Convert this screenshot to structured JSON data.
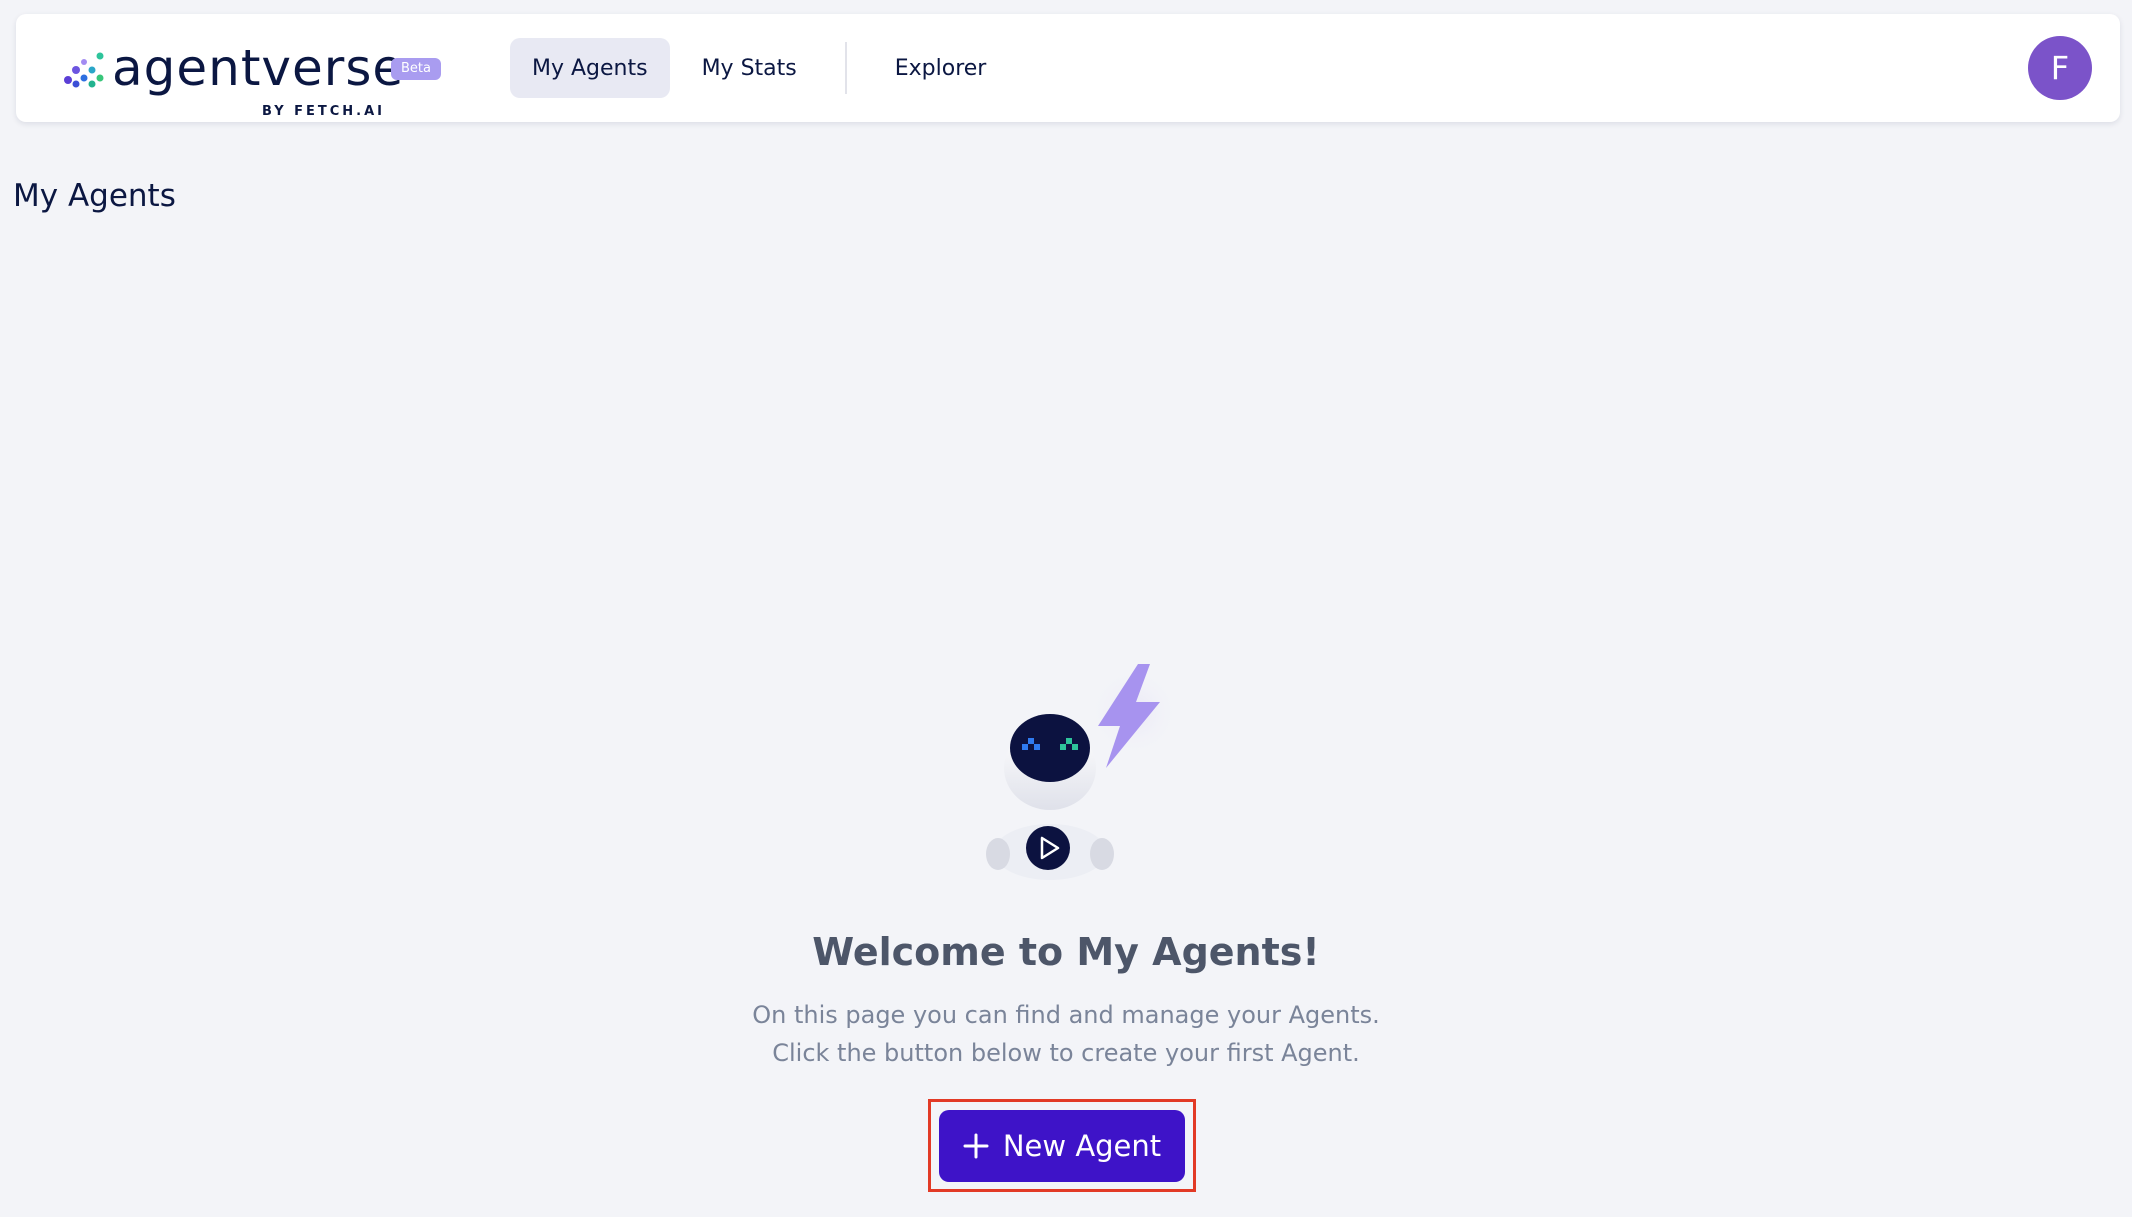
{
  "app": {
    "logo_word": "agentverse",
    "beta_badge": "Beta",
    "byline": "BY FETCH.AI"
  },
  "nav": {
    "items": [
      {
        "label": "My Agents",
        "active": true
      },
      {
        "label": "My Stats",
        "active": false
      },
      {
        "label": "Explorer",
        "active": false
      }
    ]
  },
  "user": {
    "avatar_initial": "F",
    "avatar_color": "#7b53c9"
  },
  "page": {
    "title": "My Agents"
  },
  "empty_state": {
    "illustration": "robot-agent-illustration",
    "heading": "Welcome to My Agents!",
    "line1": "On this page you can find and manage your Agents.",
    "line2": "Click the button below to create your first Agent.",
    "button_label": "New Agent",
    "button_icon": "plus-icon"
  },
  "colors": {
    "accent": "#3e13c8",
    "background": "#f3f4f8",
    "highlight_outline": "#e23a26"
  }
}
